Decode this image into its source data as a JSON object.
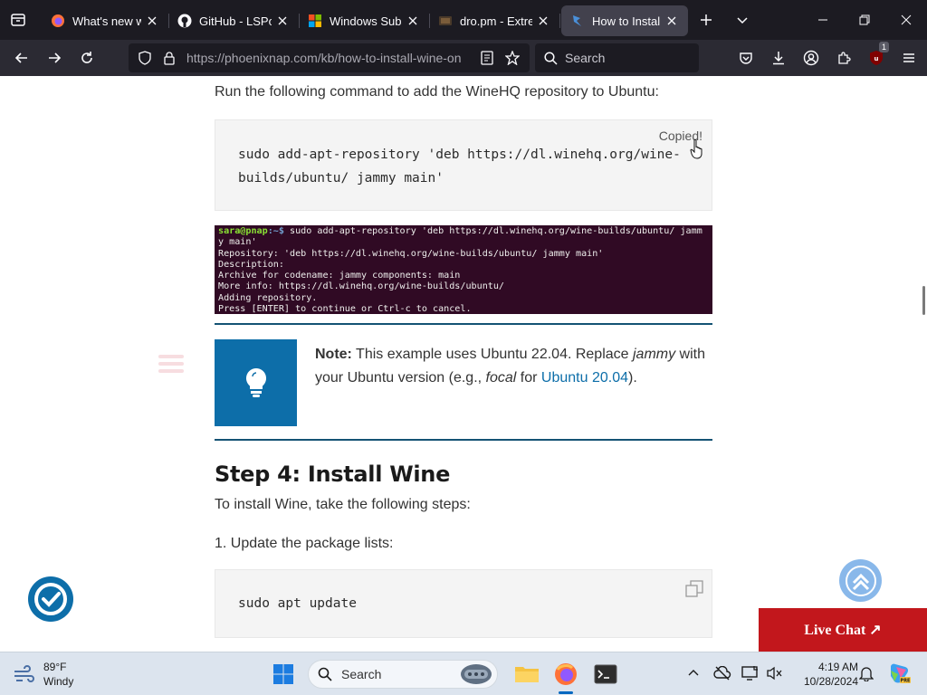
{
  "browser": {
    "tabs": [
      {
        "title": "What's new with",
        "active": false
      },
      {
        "title": "GitHub - LSPose",
        "active": false
      },
      {
        "title": "Windows Subsys",
        "active": false
      },
      {
        "title": "dro.pm - Extrem",
        "active": false
      },
      {
        "title": "How to Install W",
        "active": true
      }
    ],
    "url_domain": "https://phoenixnap.com",
    "url_path": "/kb/how-to-install-wine-on",
    "search_placeholder": "Search",
    "extension_badge": "1"
  },
  "page": {
    "intro": "Run the following command to add the WineHQ repository to Ubuntu:",
    "code1_line1": "sudo add-apt-repository 'deb https://dl.winehq.org/wine-",
    "code1_line2": "builds/ubuntu/ jammy main'",
    "copied_label": "Copied!",
    "terminal": {
      "user_host": "sara@pnap",
      "path": ":~$",
      "line1_cmd": " sudo add-apt-repository 'deb https://dl.winehq.org/wine-builds/ubuntu/ jamm",
      "line2": "y main'",
      "line3": "Repository: 'deb https://dl.winehq.org/wine-builds/ubuntu/ jammy main'",
      "line4": "Description:",
      "line5": "Archive for codename: jammy components: main",
      "line6": "More info: https://dl.winehq.org/wine-builds/ubuntu/",
      "line7": "Adding repository.",
      "line8": "Press [ENTER] to continue or Ctrl-c to cancel."
    },
    "note": {
      "label": "Note:",
      "text1": " This example uses Ubuntu 22.04. Replace ",
      "em1": "jammy",
      "text2": " with your Ubuntu version (e.g., ",
      "em2": "focal",
      "text3": " for ",
      "link": "Ubuntu 20.04",
      "text4": ")."
    },
    "heading": "Step 4: Install Wine",
    "steps_intro": "To install Wine, take the following steps:",
    "step1": "1. Update the package lists:",
    "code2": "sudo apt update",
    "live_chat": "Live Chat ↗"
  },
  "taskbar": {
    "weather_temp": "89°F",
    "weather_desc": "Windy",
    "search_label": "Search",
    "time": "4:19 AM",
    "date": "10/28/2024"
  },
  "colors": {
    "accent_blue": "#0d6ea9",
    "live_chat_red": "#c2171c",
    "terminal_bg": "#300a24",
    "browser_dark": "#1c1b22"
  }
}
